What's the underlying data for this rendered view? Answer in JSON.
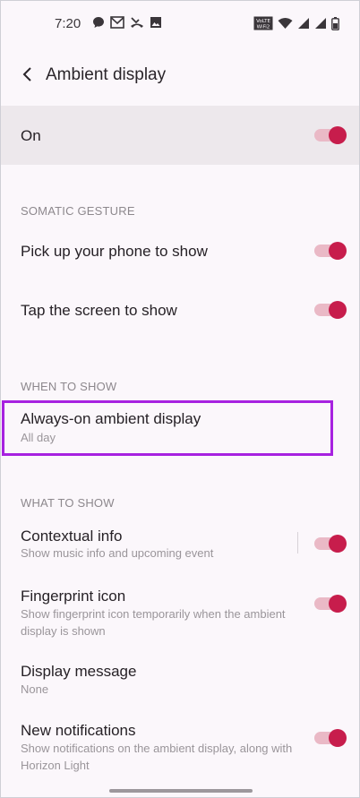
{
  "status_bar": {
    "time": "7:20",
    "left_icons": [
      "chat-bubble-icon",
      "mail-icon",
      "missed-call-icon",
      "image-icon"
    ],
    "right_icons": [
      "volte-wifi-icon",
      "wifi-icon",
      "signal-icon",
      "signal-icon",
      "battery-icon"
    ],
    "volte_label": "VoLTE WiFi2"
  },
  "header": {
    "title": "Ambient display"
  },
  "master": {
    "label": "On",
    "enabled": true
  },
  "sections": {
    "somatic": "SOMATIC GESTURE",
    "when": "WHEN TO SHOW",
    "what": "WHAT TO SHOW"
  },
  "rows": {
    "pickup": {
      "title": "Pick up your phone to show",
      "enabled": true
    },
    "tap": {
      "title": "Tap the screen to show",
      "enabled": true
    },
    "always_on": {
      "title": "Always-on ambient display",
      "subtitle": "All day"
    },
    "contextual": {
      "title": "Contextual info",
      "subtitle": "Show music info and upcoming event",
      "enabled": true
    },
    "fingerprint": {
      "title": "Fingerprint icon",
      "subtitle": "Show fingerprint icon temporarily when the ambient display is shown",
      "enabled": true
    },
    "message": {
      "title": "Display message",
      "subtitle": "None"
    },
    "notifications": {
      "title": "New notifications",
      "subtitle": "Show notifications on the ambient display, along with Horizon Light",
      "enabled": true
    }
  },
  "colors": {
    "accent": "#c71d4c",
    "accent_track": "#eab9c6",
    "highlight": "#a722e0"
  }
}
